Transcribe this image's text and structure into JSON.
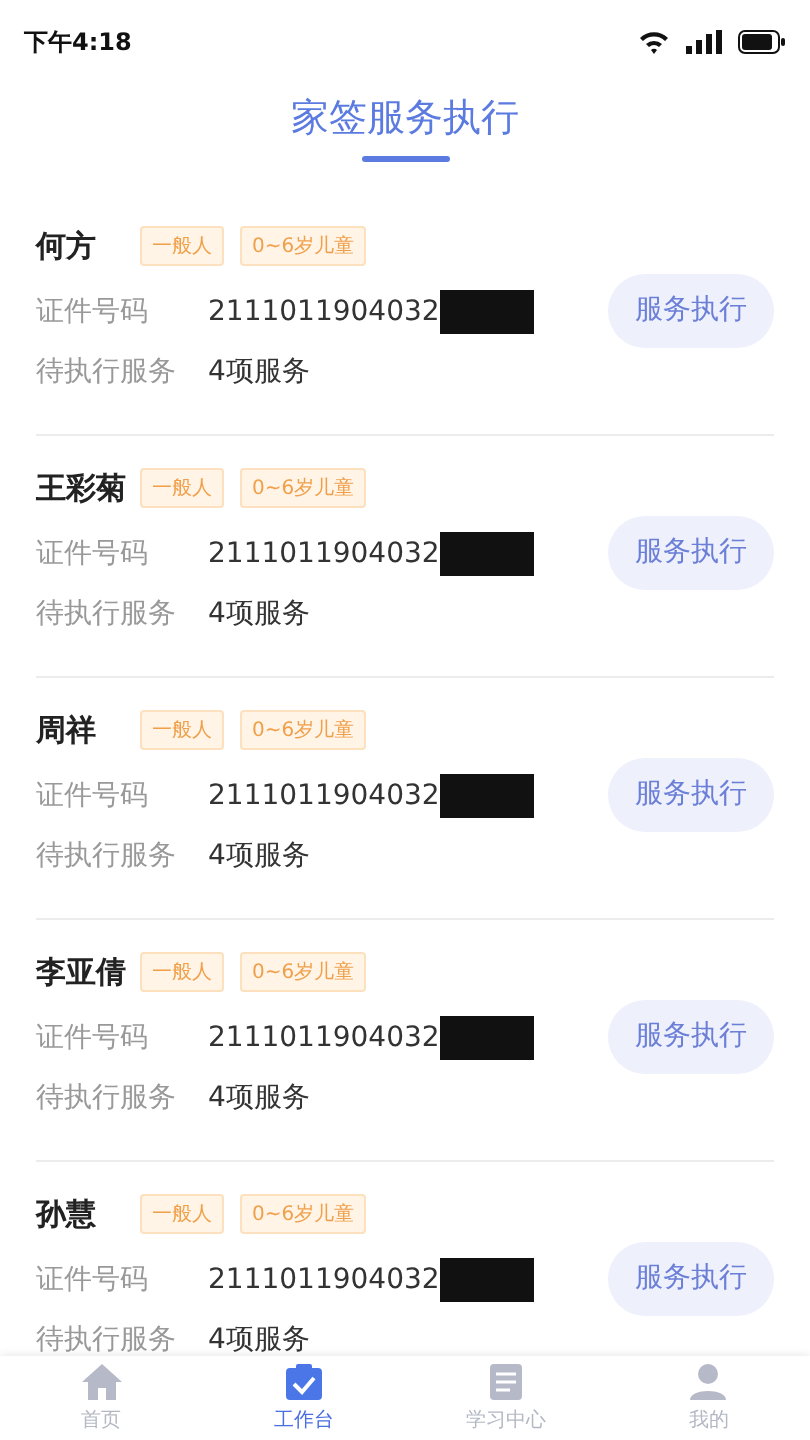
{
  "status_bar": {
    "time": "下午4:18"
  },
  "header": {
    "title": "家签服务执行"
  },
  "residents": [
    {
      "name": "何方",
      "tags": [
        "一般人",
        "0~6岁儿童"
      ],
      "id_label": "证件号码",
      "id_number": "2111011904032",
      "pending_label": "待执行服务",
      "pending": "4项服务",
      "action": "服务执行"
    },
    {
      "name": "王彩菊",
      "tags": [
        "一般人",
        "0~6岁儿童"
      ],
      "id_label": "证件号码",
      "id_number": "2111011904032",
      "pending_label": "待执行服务",
      "pending": "4项服务",
      "action": "服务执行"
    },
    {
      "name": "周祥",
      "tags": [
        "一般人",
        "0~6岁儿童"
      ],
      "id_label": "证件号码",
      "id_number": "2111011904032",
      "pending_label": "待执行服务",
      "pending": "4项服务",
      "action": "服务执行"
    },
    {
      "name": "李亚倩",
      "tags": [
        "一般人",
        "0~6岁儿童"
      ],
      "id_label": "证件号码",
      "id_number": "2111011904032",
      "pending_label": "待执行服务",
      "pending": "4项服务",
      "action": "服务执行"
    },
    {
      "name": "孙慧",
      "tags": [
        "一般人",
        "0~6岁儿童"
      ],
      "id_label": "证件号码",
      "id_number": "2111011904032",
      "pending_label": "待执行服务",
      "pending": "4项服务",
      "action": "服务执行"
    }
  ],
  "tab_bar": [
    {
      "kind": "home",
      "label": "首页",
      "selected": false
    },
    {
      "kind": "workbench",
      "label": "工作台",
      "selected": true
    },
    {
      "kind": "study",
      "label": "学习中心",
      "selected": false
    },
    {
      "kind": "profile",
      "label": "我的",
      "selected": false
    }
  ]
}
